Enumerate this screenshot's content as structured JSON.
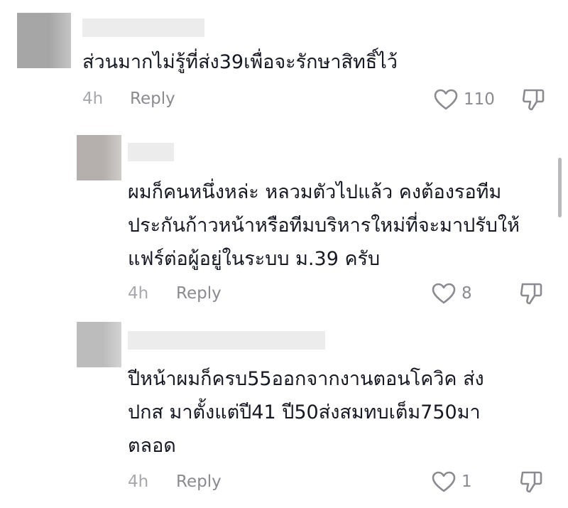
{
  "comments": [
    {
      "text_lines": [
        "ส่วนมากไม่รู้ที่ส่ง39เพื่อจะรักษาสิทธิ์ไว้"
      ],
      "time": "4h",
      "reply_label": "Reply",
      "like_count": "110",
      "avatar_color": "#a6a6a6",
      "like_icon": "heart-outline-icon",
      "dislike_icon": "thumbs-down-icon"
    },
    {
      "text_lines": [
        "ผมก็คนหนึ่งหล่ะ หลวมตัวไปแล้ว คงต้องรอทีม",
        "ประกันก้าวหน้าหรือทีมบริหารใหม่ที่จะมาปรับให้",
        "แฟร์ต่อผู้อยู่ในระบบ ม.39 ครับ"
      ],
      "time": "4h",
      "reply_label": "Reply",
      "like_count": "8",
      "avatar_color": "#b5b0ad",
      "like_icon": "heart-outline-icon",
      "dislike_icon": "thumbs-down-icon"
    },
    {
      "text_lines": [
        "ปีหน้าผมก็ครบ55ออกจากงานตอนโควิค ส่ง",
        "ปกส มาตั้งแต่ปี41 ปี50ส่งสมทบเต็ม750มา",
        "ตลอด"
      ],
      "time": "4h",
      "reply_label": "Reply",
      "like_count": "1",
      "avatar_color": "#bcbcbc",
      "like_icon": "heart-outline-icon",
      "dislike_icon": "thumbs-down-icon"
    }
  ]
}
